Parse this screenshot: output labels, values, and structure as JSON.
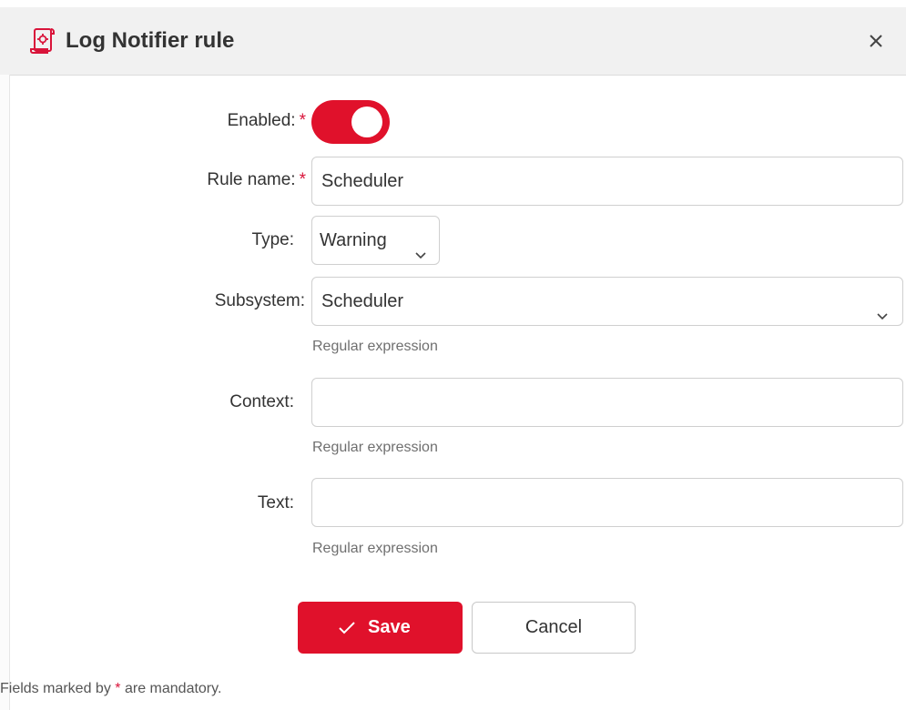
{
  "dialog": {
    "title": "Log Notifier rule",
    "title_icon": "scroll-gear-icon",
    "close_icon": "close-icon",
    "accent_color": "#e0112b"
  },
  "form": {
    "enabled": {
      "label": "Enabled:",
      "required_mark": "*",
      "value": true
    },
    "rule_name": {
      "label": "Rule name:",
      "required_mark": "*",
      "value": "Scheduler"
    },
    "type": {
      "label": "Type:",
      "selected": "Warning"
    },
    "subsystem": {
      "label": "Subsystem:",
      "selected": "Scheduler",
      "hint": "Regular expression"
    },
    "context": {
      "label": "Context:",
      "value": "",
      "hint": "Regular expression"
    },
    "text": {
      "label": "Text:",
      "value": "",
      "hint": "Regular expression"
    }
  },
  "buttons": {
    "save_label": "Save",
    "save_icon": "checkmark-icon",
    "cancel_label": "Cancel"
  },
  "footer": {
    "note_before": "Fields marked by",
    "note_mark": "*",
    "note_after": "are mandatory."
  }
}
